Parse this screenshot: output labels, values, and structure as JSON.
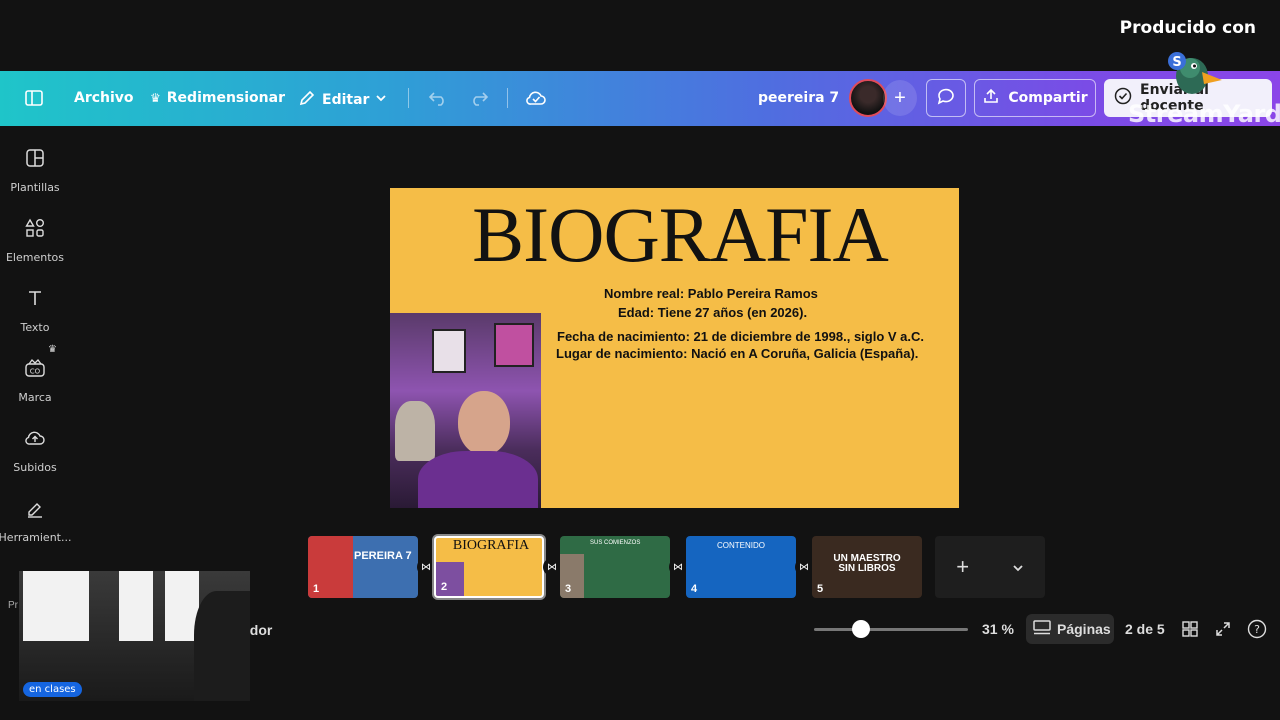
{
  "overlay": {
    "producido": "Producido con",
    "streamyard": "StreamYard"
  },
  "toolbar": {
    "archivo": "Archivo",
    "redimensionar": "Redimensionar",
    "editar": "Editar",
    "project_name": "peereira 7",
    "share": "Compartir",
    "send": "Enviar al docente"
  },
  "sidebar": {
    "items": [
      {
        "label": "Plantillas",
        "icon": "template-icon"
      },
      {
        "label": "Elementos",
        "icon": "elements-icon"
      },
      {
        "label": "Texto",
        "icon": "text-icon"
      },
      {
        "label": "Marca",
        "icon": "brand-icon"
      },
      {
        "label": "Subidos",
        "icon": "upload-icon"
      },
      {
        "label": "Herramient...",
        "icon": "tools-icon"
      }
    ]
  },
  "slide": {
    "title": "BIOGRAFIA",
    "lines": [
      "Nombre real: Pablo Pereira Ramos",
      "Edad: Tiene 27 años (en 2026).",
      "Fecha de nacimiento: 21 de diciembre de 1998., siglo V a.C.",
      "Lugar de nacimiento: Nació en A Coruña, Galicia (España)."
    ]
  },
  "thumbnails": [
    {
      "num": "1",
      "label": "PEREIRA 7",
      "color": "#3d6fb0"
    },
    {
      "num": "2",
      "label": "BIOGRAFIA",
      "color": "#f5bd47"
    },
    {
      "num": "3",
      "label": "SUS COMIENZOS",
      "color": "#2f6b45"
    },
    {
      "num": "4",
      "label": "CONTENIDO",
      "color": "#1565c0"
    },
    {
      "num": "5",
      "label": "UN MAESTRO SIN LIBROS",
      "color": "#3a2a20"
    }
  ],
  "footer": {
    "zoom": "31 %",
    "zoom_level": 0.31,
    "pages_label": "Páginas",
    "page_count": "2 de 5",
    "ador": "ador",
    "pr": "Pr"
  },
  "webcam": {
    "badge": "en clases"
  },
  "colors": {
    "slide_bg": "#f5bd47",
    "toolbar_start": "#1fc5c9",
    "toolbar_end": "#8b45e8",
    "accent": "#1565e0"
  }
}
